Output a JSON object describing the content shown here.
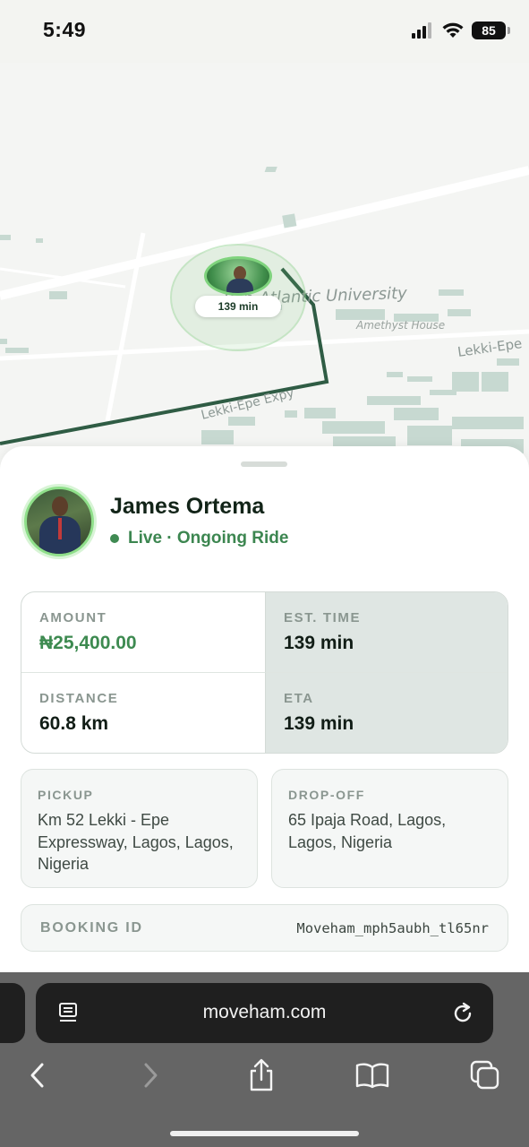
{
  "status_bar": {
    "time": "5:49",
    "battery": "85"
  },
  "map": {
    "labels": {
      "university": "Pan-Atlantic University",
      "amethyst": "Amethyst House",
      "lekki_epe_right": "Lekki-Epe",
      "lekki_epe_expy": "Lekki-Epe Expy"
    },
    "marker_label": "139 min"
  },
  "driver": {
    "name": "James Ortema",
    "status": "Live · Ongoing Ride"
  },
  "metrics": {
    "amount_label": "AMOUNT",
    "amount_value": "₦25,400.00",
    "est_time_label": "EST. TIME",
    "est_time_value": "139 min",
    "distance_label": "DISTANCE",
    "distance_value": "60.8 km",
    "eta_label": "ETA",
    "eta_value": "139 min"
  },
  "pickup": {
    "label": "PICKUP",
    "address": "Km 52 Lekki - Epe Expressway, Lagos, Lagos, Nigeria"
  },
  "dropoff": {
    "label": "DROP-OFF",
    "address": "65 Ipaja Road, Lagos, Lagos, Nigeria"
  },
  "booking": {
    "label": "BOOKING ID",
    "value": "Moveham_mph5aubh_tl65nr"
  },
  "browser": {
    "url": "moveham.com"
  },
  "colors": {
    "accent_green": "#3d8a50",
    "route": "#2f5c44",
    "panel_grey": "#dfe6e3"
  }
}
